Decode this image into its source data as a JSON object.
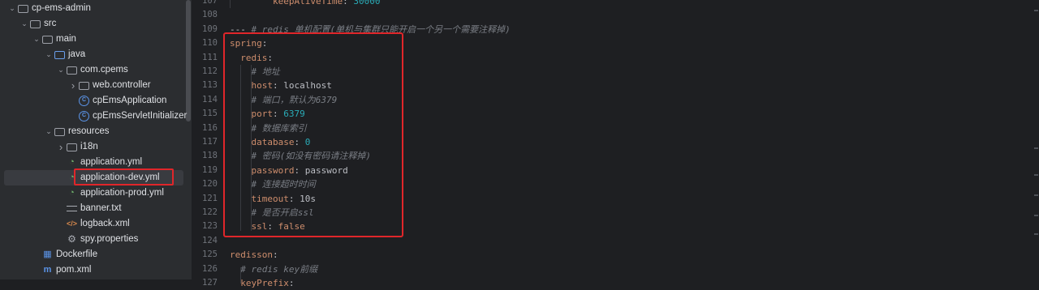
{
  "tree": {
    "items": [
      {
        "label": "cp-ems-admin",
        "icon": "folder-icon",
        "depth": 0,
        "chevron": "down"
      },
      {
        "label": "src",
        "icon": "folder-icon",
        "depth": 1,
        "chevron": "down"
      },
      {
        "label": "main",
        "icon": "folder-icon",
        "depth": 2,
        "chevron": "down"
      },
      {
        "label": "java",
        "icon": "source-folder-icon",
        "depth": 3,
        "chevron": "down"
      },
      {
        "label": "com.cpems",
        "icon": "package-icon",
        "depth": 4,
        "chevron": "down"
      },
      {
        "label": "web.controller",
        "icon": "package-icon",
        "depth": 5,
        "chevron": "right"
      },
      {
        "label": "cpEmsApplication",
        "icon": "class-icon",
        "depth": 5,
        "chevron": ""
      },
      {
        "label": "cpEmsServletInitializer",
        "icon": "class-icon",
        "depth": 5,
        "chevron": ""
      },
      {
        "label": "resources",
        "icon": "resources-folder-icon",
        "depth": 3,
        "chevron": "down"
      },
      {
        "label": "i18n",
        "icon": "folder-icon",
        "depth": 4,
        "chevron": "right"
      },
      {
        "label": "application.yml",
        "icon": "yaml-file-icon",
        "depth": 4,
        "chevron": ""
      },
      {
        "label": "application-dev.yml",
        "icon": "yaml-file-icon",
        "depth": 4,
        "chevron": "",
        "selected": true
      },
      {
        "label": "application-prod.yml",
        "icon": "yaml-file-icon",
        "depth": 4,
        "chevron": ""
      },
      {
        "label": "banner.txt",
        "icon": "text-file-icon",
        "depth": 4,
        "chevron": ""
      },
      {
        "label": "logback.xml",
        "icon": "xml-file-icon",
        "depth": 4,
        "chevron": ""
      },
      {
        "label": "spy.properties",
        "icon": "properties-file-icon",
        "depth": 4,
        "chevron": ""
      },
      {
        "label": "Dockerfile",
        "icon": "docker-file-icon",
        "depth": 2,
        "chevron": ""
      },
      {
        "label": "pom.xml",
        "icon": "maven-file-icon",
        "depth": 2,
        "chevron": ""
      }
    ]
  },
  "editor": {
    "lines": [
      {
        "num": "107",
        "tokens": [
          {
            "t": "        ",
            "c": ""
          },
          {
            "t": "keepAliveTime",
            "c": "k"
          },
          {
            "t": ": ",
            "c": "v"
          },
          {
            "t": "30000",
            "c": "n"
          }
        ]
      },
      {
        "num": "108",
        "tokens": []
      },
      {
        "num": "109",
        "tokens": [
          {
            "t": "--- ",
            "c": "v"
          },
          {
            "t": "# redis 单机配置(单机与集群只能开启一个另一个需要注释掉)",
            "c": "c"
          }
        ]
      },
      {
        "num": "110",
        "tokens": [
          {
            "t": "spring",
            "c": "k"
          },
          {
            "t": ":",
            "c": "v"
          }
        ]
      },
      {
        "num": "111",
        "tokens": [
          {
            "t": "  ",
            "c": ""
          },
          {
            "t": "redis",
            "c": "k"
          },
          {
            "t": ":",
            "c": "v"
          }
        ]
      },
      {
        "num": "112",
        "tokens": [
          {
            "t": "    ",
            "c": ""
          },
          {
            "t": "# 地址",
            "c": "c"
          }
        ]
      },
      {
        "num": "113",
        "tokens": [
          {
            "t": "    ",
            "c": ""
          },
          {
            "t": "host",
            "c": "k"
          },
          {
            "t": ": localhost",
            "c": "v"
          }
        ]
      },
      {
        "num": "114",
        "tokens": [
          {
            "t": "    ",
            "c": ""
          },
          {
            "t": "# 端口，默认为6379",
            "c": "c"
          }
        ]
      },
      {
        "num": "115",
        "tokens": [
          {
            "t": "    ",
            "c": ""
          },
          {
            "t": "port",
            "c": "k"
          },
          {
            "t": ": ",
            "c": "v"
          },
          {
            "t": "6379",
            "c": "n"
          }
        ]
      },
      {
        "num": "116",
        "tokens": [
          {
            "t": "    ",
            "c": ""
          },
          {
            "t": "# 数据库索引",
            "c": "c"
          }
        ]
      },
      {
        "num": "117",
        "tokens": [
          {
            "t": "    ",
            "c": ""
          },
          {
            "t": "database",
            "c": "k"
          },
          {
            "t": ": ",
            "c": "v"
          },
          {
            "t": "0",
            "c": "n"
          }
        ]
      },
      {
        "num": "118",
        "tokens": [
          {
            "t": "    ",
            "c": ""
          },
          {
            "t": "# 密码(如没有密码请注释掉)",
            "c": "c"
          }
        ]
      },
      {
        "num": "119",
        "tokens": [
          {
            "t": "    ",
            "c": ""
          },
          {
            "t": "password",
            "c": "k"
          },
          {
            "t": ": password",
            "c": "v"
          }
        ]
      },
      {
        "num": "120",
        "tokens": [
          {
            "t": "    ",
            "c": ""
          },
          {
            "t": "# 连接超时时间",
            "c": "c"
          }
        ]
      },
      {
        "num": "121",
        "tokens": [
          {
            "t": "    ",
            "c": ""
          },
          {
            "t": "timeout",
            "c": "k"
          },
          {
            "t": ": 10s",
            "c": "v"
          }
        ]
      },
      {
        "num": "122",
        "tokens": [
          {
            "t": "    ",
            "c": ""
          },
          {
            "t": "# 是否开启ssl",
            "c": "c"
          }
        ]
      },
      {
        "num": "123",
        "tokens": [
          {
            "t": "    ",
            "c": ""
          },
          {
            "t": "ssl",
            "c": "k"
          },
          {
            "t": ": ",
            "c": "v"
          },
          {
            "t": "false",
            "c": "k"
          }
        ]
      },
      {
        "num": "124",
        "tokens": []
      },
      {
        "num": "125",
        "tokens": [
          {
            "t": "redisson",
            "c": "k"
          },
          {
            "t": ":",
            "c": "v"
          }
        ]
      },
      {
        "num": "126",
        "tokens": [
          {
            "t": "  ",
            "c": ""
          },
          {
            "t": "# redis key前缀",
            "c": "c"
          }
        ]
      },
      {
        "num": "127",
        "tokens": [
          {
            "t": "  ",
            "c": ""
          },
          {
            "t": "keyPrefix",
            "c": "k"
          },
          {
            "t": ":",
            "c": "v"
          }
        ]
      }
    ]
  },
  "colors": {
    "keyword": "#cf8e6d",
    "number": "#2aacb8",
    "comment": "#7a7e85",
    "highlight": "#e0262a"
  }
}
